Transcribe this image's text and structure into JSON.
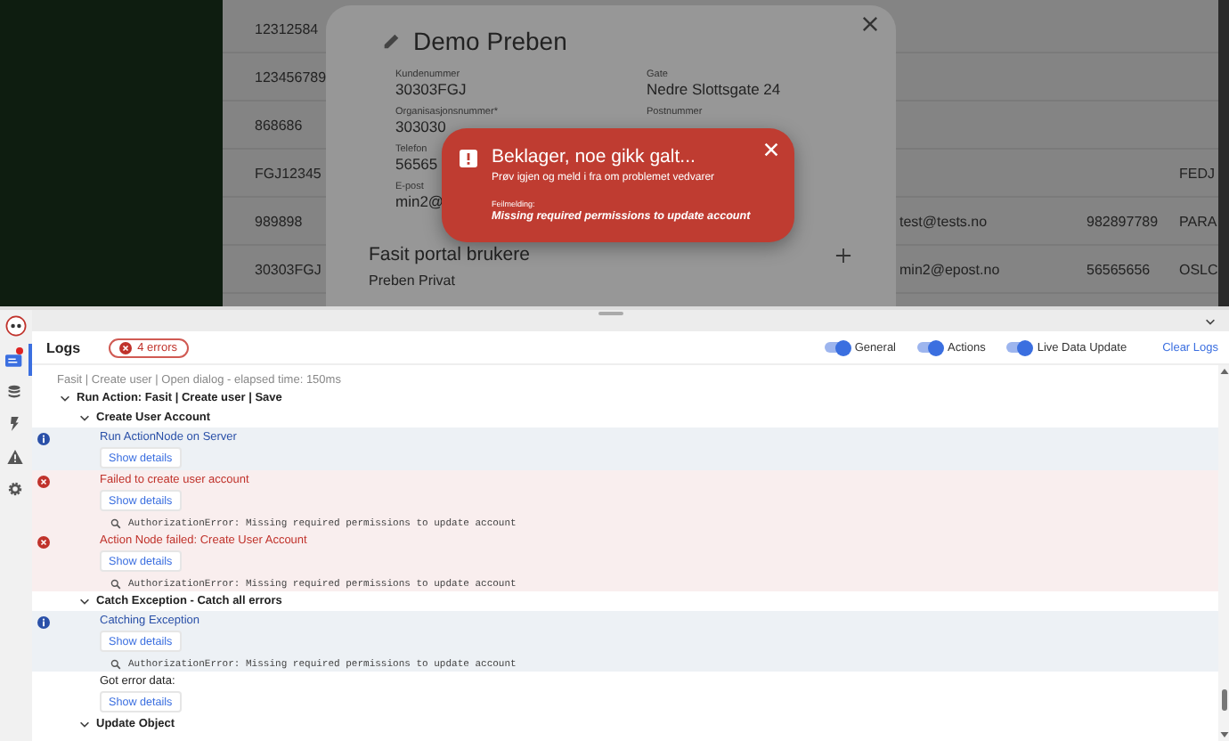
{
  "table": {
    "rows": [
      {
        "column_1": "12312584"
      },
      {
        "column_1": "123456789"
      },
      {
        "column_1": "868686"
      },
      {
        "column_1": "FGJ12345",
        "column_4": "FEDJ"
      },
      {
        "column_1": "989898",
        "column_2": "test@tests.no",
        "column_3": "982897789",
        "column_4": "PARA"
      },
      {
        "column_1": "30303FGJ",
        "column_2": "min2@epost.no",
        "column_3": "56565656",
        "column_4": "OSLC"
      }
    ]
  },
  "dialog": {
    "title": "Demo Preben",
    "left_fields": [
      {
        "label": "Kundenummer",
        "value": "30303FGJ"
      },
      {
        "label": "Organisasjonsnummer*",
        "value": "303030"
      },
      {
        "label": "Telefon",
        "value": "56565"
      },
      {
        "label": "E-post",
        "value": "min2@"
      }
    ],
    "right_fields": [
      {
        "label": "Gate",
        "value": "Nedre Slottsgate 24"
      },
      {
        "label": "Postnummer"
      }
    ],
    "section": {
      "title": "Fasit portal brukere",
      "items": [
        "Preben Privat"
      ]
    }
  },
  "toast": {
    "title": "Beklager, noe gikk galt...",
    "message": "Prøv igjen og meld i fra om problemet vedvarer",
    "detail_label": "Feilmelding:",
    "detail": "Missing required permissions to update account"
  },
  "devtools": {
    "tabs": [
      {
        "kind": "logs",
        "selected": true,
        "notification": true
      },
      {
        "kind": "database",
        "selected": false,
        "notification": false
      },
      {
        "kind": "bolt",
        "selected": false,
        "notification": false
      },
      {
        "kind": "warning",
        "selected": false,
        "notification": false
      },
      {
        "kind": "settings",
        "selected": false,
        "notification": false
      }
    ],
    "logs": {
      "title": "Logs",
      "error_badge": "4 errors",
      "toggles": [
        {
          "label": "General",
          "on": true
        },
        {
          "label": "Actions",
          "on": true
        },
        {
          "label": "Live Data Update",
          "on": true
        }
      ],
      "clear_label": "Clear Logs",
      "entries": [
        {
          "kind": "text",
          "message": "Fasit | Create user | Open dialog - elapsed time: 150ms"
        },
        {
          "kind": "group",
          "message": "Run Action: Fasit | Create user | Save",
          "expanded": true,
          "children": [
            {
              "kind": "group",
              "message": "Create User Account",
              "expanded": true,
              "children": [
                {
                  "kind": "info",
                  "message": "Run ActionNode on Server",
                  "button": "Show details"
                },
                {
                  "kind": "error",
                  "message": "Failed to create user account",
                  "button": "Show details",
                  "detail": "AuthorizationError: Missing required permissions to update account"
                },
                {
                  "kind": "error",
                  "message": "Action Node failed: Create User Account",
                  "button": "Show details",
                  "detail": "AuthorizationError: Missing required permissions to update account"
                }
              ]
            },
            {
              "kind": "group",
              "message": "Catch Exception - Catch all errors",
              "expanded": true,
              "children": [
                {
                  "kind": "info",
                  "message": "Catching Exception",
                  "button": "Show details",
                  "detail": "AuthorizationError: Missing required permissions to update account"
                },
                {
                  "kind": "plain",
                  "message": "Got error data:",
                  "button": "Show details"
                }
              ]
            },
            {
              "kind": "group",
              "message": "Update Object",
              "expanded": true
            }
          ]
        }
      ]
    }
  }
}
